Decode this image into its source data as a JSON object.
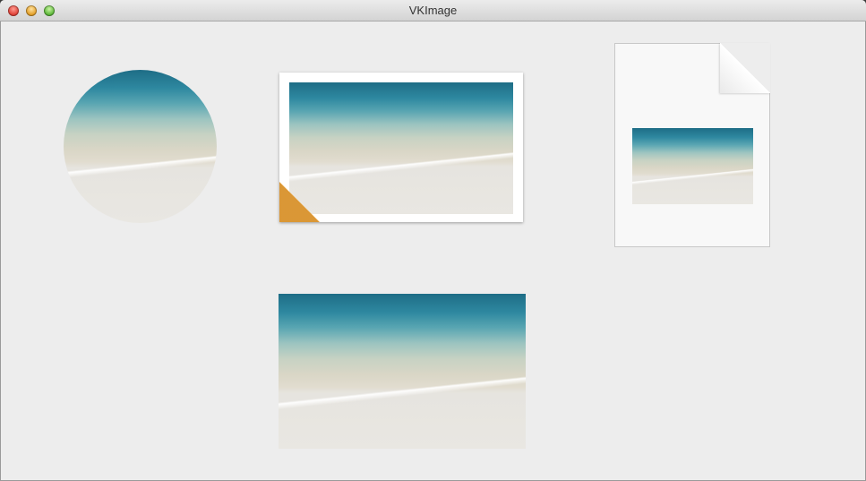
{
  "window": {
    "title": "VKImage"
  },
  "images": [
    {
      "name": "circle-cropped-image",
      "style": "circle"
    },
    {
      "name": "photo-frame-image",
      "style": "framed with folded corner",
      "corner_color": "#eda43a"
    },
    {
      "name": "document-thumbnail-image",
      "style": "document page"
    },
    {
      "name": "plain-image",
      "style": "plain"
    }
  ],
  "colors": {
    "background": "#ededed",
    "water": "#2e88a0",
    "sand": "#e6e4df"
  }
}
